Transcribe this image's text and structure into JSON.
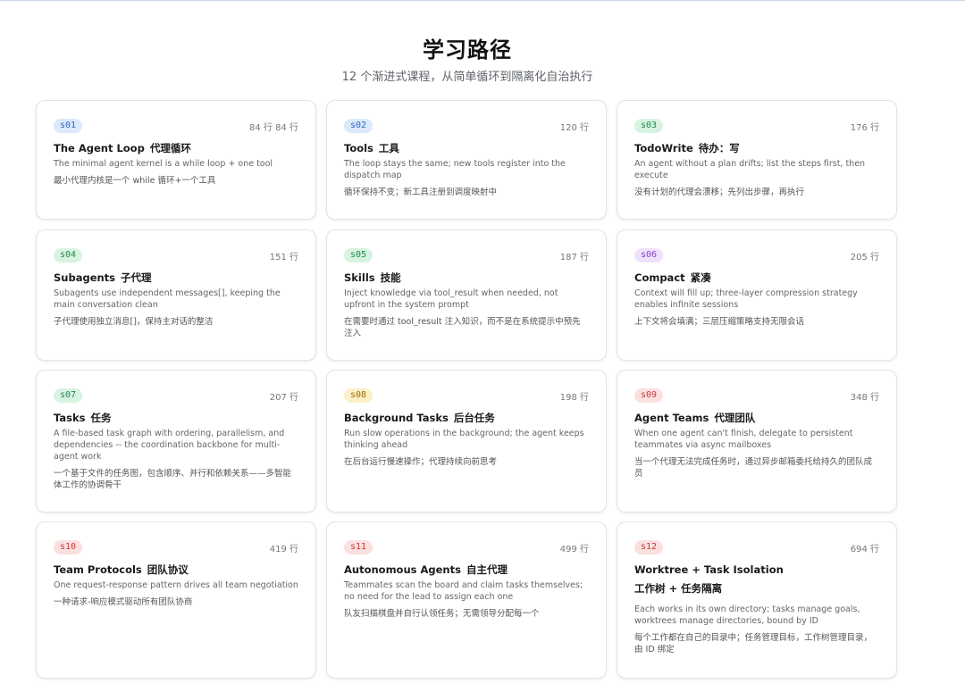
{
  "header": {
    "title": "学习路径",
    "subtitle": "12 个渐进式课程，从简单循环到隔离化自治执行"
  },
  "badge_colors": {
    "blue": {
      "bg": "#dbe9fb",
      "fg": "#2f66c4"
    },
    "green": {
      "bg": "#d8f3e2",
      "fg": "#1f8a4c"
    },
    "purple": {
      "bg": "#efe1fb",
      "fg": "#8a3fc6"
    },
    "yellow": {
      "bg": "#fbf0c7",
      "fg": "#9a6a06"
    },
    "red": {
      "bg": "#fbe0e0",
      "fg": "#c43b3b"
    }
  },
  "cards": [
    {
      "id": "s01",
      "color": "blue",
      "lines": "84 行  84 行",
      "title_en": "The Agent Loop",
      "title_zh": "代理循环",
      "desc_en": "The minimal agent kernel is a while loop + one tool",
      "desc_zh": "最小代理内核是一个 while 循环+一个工具"
    },
    {
      "id": "s02",
      "color": "blue",
      "lines": "120 行",
      "title_en": "Tools",
      "title_zh": "工具",
      "desc_en": "The loop stays the same; new tools register into the dispatch map",
      "desc_zh": "循环保持不变；新工具注册到调度映射中"
    },
    {
      "id": "s03",
      "color": "green",
      "lines": "176 行",
      "title_en": "TodoWrite",
      "title_zh": "待办：写",
      "desc_en": "An agent without a plan drifts; list the steps first, then execute",
      "desc_zh": "没有计划的代理会漂移；先列出步骤，再执行"
    },
    {
      "id": "s04",
      "color": "green",
      "lines": "151 行",
      "title_en": "Subagents",
      "title_zh": "子代理",
      "desc_en": "Subagents use independent messages[], keeping the main conversation clean",
      "desc_zh": "子代理使用独立消息[]，保持主对话的整洁"
    },
    {
      "id": "s05",
      "color": "green",
      "lines": "187 行",
      "title_en": "Skills",
      "title_zh": "技能",
      "desc_en": "Inject knowledge via tool_result when needed, not upfront in the system prompt",
      "desc_zh": "在需要时通过 tool_result 注入知识，而不是在系统提示中预先注入"
    },
    {
      "id": "s06",
      "color": "purple",
      "lines": "205 行",
      "title_en": "Compact",
      "title_zh": "紧凑",
      "desc_en": "Context will fill up; three-layer compression strategy enables infinite sessions",
      "desc_zh": "上下文将会填满；三层压缩策略支持无限会话"
    },
    {
      "id": "s07",
      "color": "green",
      "lines": "207 行",
      "title_en": "Tasks",
      "title_zh": "任务",
      "desc_en": "A file-based task graph with ordering, parallelism, and dependencies -- the coordination backbone for multi-agent work",
      "desc_zh": "一个基于文件的任务图，包含顺序、并行和依赖关系——多智能体工作的协调骨干"
    },
    {
      "id": "s08",
      "color": "yellow",
      "lines": "198 行",
      "title_en": "Background Tasks",
      "title_zh": "后台任务",
      "desc_en": "Run slow operations in the background; the agent keeps thinking ahead",
      "desc_zh": "在后台运行慢速操作；代理持续向前思考"
    },
    {
      "id": "s09",
      "color": "red",
      "lines": "348 行",
      "title_en": "Agent Teams",
      "title_zh": "代理团队",
      "desc_en": "When one agent can't finish, delegate to persistent teammates via async mailboxes",
      "desc_zh": "当一个代理无法完成任务时，通过异步邮箱委托给持久的团队成员"
    },
    {
      "id": "s10",
      "color": "red",
      "lines": "419 行",
      "title_en": "Team Protocols",
      "title_zh": "团队协议",
      "desc_en": "One request-response pattern drives all team negotiation",
      "desc_zh": "一种请求-响应模式驱动所有团队协商"
    },
    {
      "id": "s11",
      "color": "red",
      "lines": "499 行",
      "title_en": "Autonomous Agents",
      "title_zh": "自主代理",
      "desc_en": "Teammates scan the board and claim tasks themselves; no need for the lead to assign each one",
      "desc_zh": "队友扫描棋盘并自行认领任务；无需领导分配每一个"
    },
    {
      "id": "s12",
      "color": "red",
      "lines": "694 行",
      "title_en": "Worktree + Task Isolation",
      "title_zh": "工作树 + 任务隔离",
      "desc_en": "Each works in its own directory; tasks manage goals, worktrees manage directories, bound by ID",
      "desc_zh": "每个工作都在自己的目录中；任务管理目标，工作树管理目录，由 ID 绑定"
    }
  ]
}
